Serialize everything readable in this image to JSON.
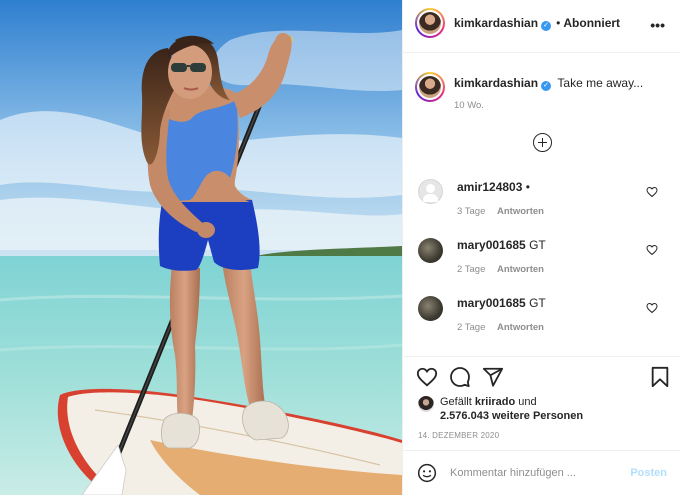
{
  "header": {
    "username": "kimkardashian",
    "separator": "•",
    "follow_status": "Abonniert"
  },
  "caption": {
    "username": "kimkardashian",
    "text": "Take me away...",
    "age": "10 Wo."
  },
  "comments": [
    {
      "username": "amir124803",
      "text": "•",
      "age": "3 Tage",
      "reply_label": "Antworten"
    },
    {
      "username": "mary001685",
      "text": "GT",
      "age": "2 Tage",
      "reply_label": "Antworten"
    },
    {
      "username": "mary001685",
      "text": "GT",
      "age": "2 Tage",
      "reply_label": "Antworten"
    }
  ],
  "likes": {
    "prefix": "Gefällt",
    "first_liker": "kriirado",
    "joiner": "und",
    "count_text": "2.576.043 weitere Personen"
  },
  "post_date": "14. DEZEMBER 2020",
  "comment_box": {
    "placeholder": "Kommentar hinzufügen ...",
    "submit_label": "Posten"
  },
  "colors": {
    "verified": "#3897f0",
    "post_button_disabled": "#b2dffc"
  }
}
